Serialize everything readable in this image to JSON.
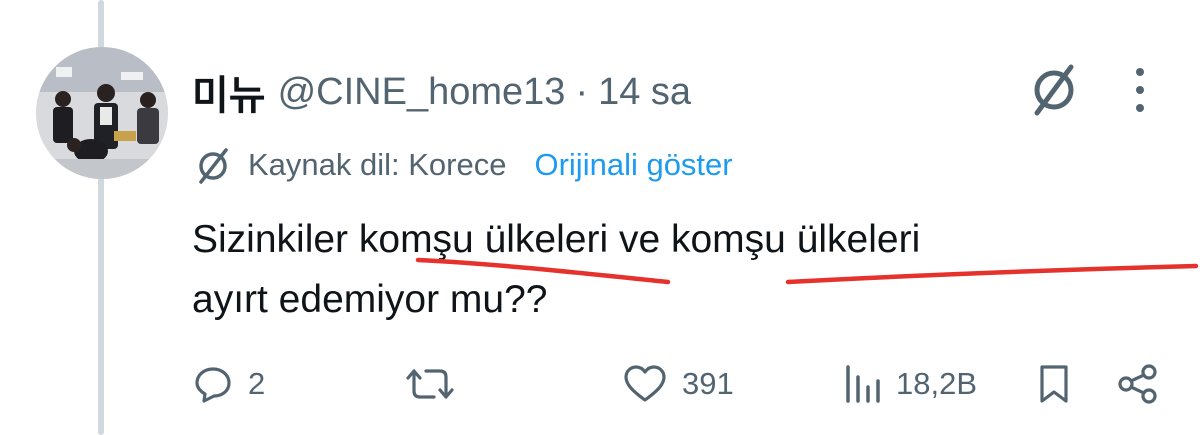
{
  "tweet": {
    "display_name": "미뉴",
    "handle": "@CINE_home13",
    "separator": "·",
    "time": "14 sa",
    "translation_note": "Kaynak dil: Korece",
    "show_original_label": "Orijinali göster",
    "text": "Sizinkiler komşu ülkeleri ve komşu ülkeleri\nayırt edemiyor mu??"
  },
  "actions": {
    "replies": "2",
    "reposts": "",
    "likes": "391",
    "views": "18,2B"
  },
  "icons": {
    "grok": "slashed-circle-icon",
    "more": "vertical-dots-icon",
    "translate": "slashed-circle-icon",
    "reply": "reply-icon",
    "repost": "repost-icon",
    "like": "heart-icon",
    "views": "views-icon",
    "bookmark": "bookmark-icon",
    "share": "share-icon"
  },
  "colors": {
    "text": "#0f1419",
    "secondary": "#536471",
    "link": "#1d9bf0",
    "annotation": "#e5322d",
    "thread_line": "#cfd9de"
  }
}
